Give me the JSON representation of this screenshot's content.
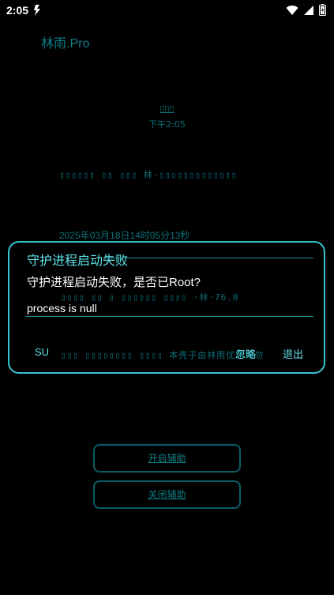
{
  "status_bar": {
    "time": "2:05",
    "icons": [
      "app-notification-icon",
      "wifi-icon",
      "signal-icon",
      "battery-icon"
    ]
  },
  "app": {
    "title": "林雨.Pro"
  },
  "background": {
    "top_glyphs": "▯▯▯",
    "top_time": "下午2:05",
    "line1": "▯▯▯▯▯▯ ▯▯ ▯▯▯ 林·▯▯▯▯▯▯▯▯▯▯▯▯▯",
    "date": "2025年03月18日14时05分13秒",
    "line3": "▯▯▯▯ ▯▯ ▯ ▯▯▯▯▯▯ ▯▯▯▯ ·林·76.0",
    "line4": "▯▯▯ ▯▯▯▯▯▯▯▯ ▯▯▯▯ 本壳子由林雨优化请勿"
  },
  "buttons": {
    "enable": "开启辅助",
    "disable": "关闭辅助"
  },
  "dialog": {
    "title": "守护进程启动失败",
    "message": "守护进程启动失败，是否已Root?",
    "detail": "process is null",
    "su": "SU",
    "ignore": "忽略",
    "exit": "退出"
  },
  "colors": {
    "accent": "#34c4cf",
    "teal_dim": "#0c6f78",
    "background": "#000000"
  }
}
